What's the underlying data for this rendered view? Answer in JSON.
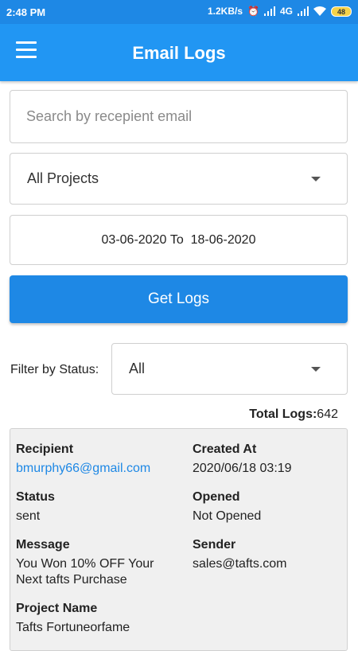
{
  "statusbar": {
    "time": "2:48 PM",
    "speed": "1.2KB/s",
    "network": "4G",
    "battery": "48"
  },
  "appbar": {
    "title": "Email Logs"
  },
  "search": {
    "placeholder": "Search by recepient email",
    "value": ""
  },
  "project_select": {
    "selected": "All Projects"
  },
  "date_range": {
    "from": "03-06-2020",
    "to": "18-06-2020",
    "separator": "To"
  },
  "get_logs_button": "Get Logs",
  "status_filter": {
    "label": "Filter by Status:",
    "selected": "All"
  },
  "total_logs": {
    "label": "Total Logs:",
    "value": "642"
  },
  "log": {
    "recipient_label": "Recipient",
    "recipient": "bmurphy66@gmail.com",
    "created_label": "Created At",
    "created": "2020/06/18 03:19",
    "status_label": "Status",
    "status": "sent",
    "opened_label": "Opened",
    "opened": "Not Opened",
    "message_label": "Message",
    "message": "You Won 10% OFF Your Next tafts Purchase",
    "sender_label": "Sender",
    "sender": "sales@tafts.com",
    "project_label": "Project Name",
    "project": "Tafts Fortuneorfame"
  }
}
